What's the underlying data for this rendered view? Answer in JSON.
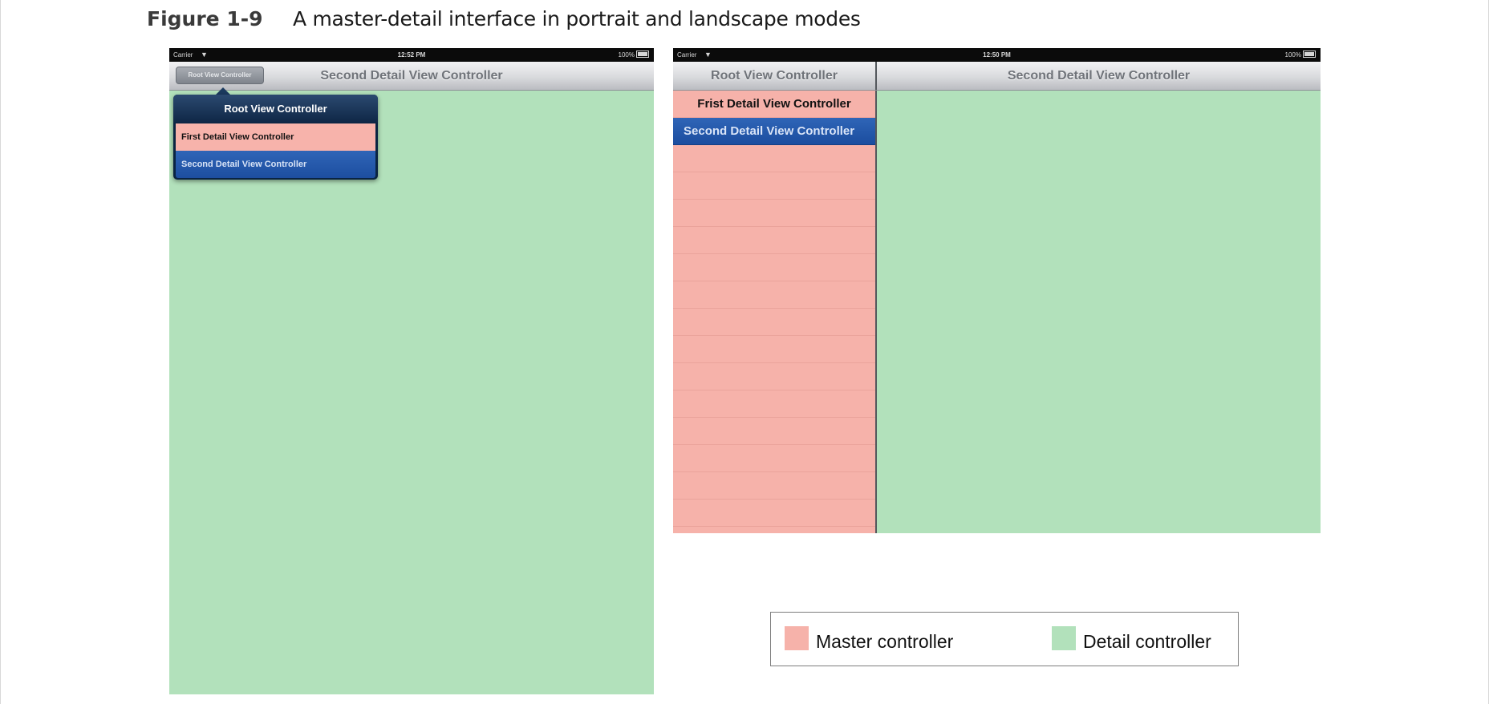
{
  "figure": {
    "number": "Figure 1-9",
    "title": "A master-detail interface in portrait and landscape modes"
  },
  "portrait": {
    "status_bar": {
      "carrier": "Carrier",
      "time": "12:52 PM",
      "battery": "100%"
    },
    "nav_bar": {
      "button_label": "Root View Controller",
      "title": "Second Detail View Controller"
    },
    "popover": {
      "title": "Root View Controller",
      "items": [
        {
          "label": "First Detail View Controller"
        },
        {
          "label": "Second Detail View Controller"
        }
      ]
    }
  },
  "landscape": {
    "status_bar": {
      "carrier": "Carrier",
      "time": "12:50 PM",
      "battery": "100%"
    },
    "nav_bar": {
      "master_title": "Root View Controller",
      "detail_title": "Second Detail View Controller"
    },
    "master_items": [
      {
        "label": "Frist Detail View Controller"
      },
      {
        "label": "Second Detail View Controller"
      }
    ]
  },
  "legend": {
    "items": [
      {
        "label": "Master controller",
        "color": "#f6b2aa"
      },
      {
        "label": "Detail controller",
        "color": "#b2e1bb"
      }
    ]
  },
  "colors": {
    "master": "#f6b2aa",
    "detail": "#b2e1bb",
    "selection_blue": "#2f65b7",
    "popover_navy": "#0a2442"
  },
  "icons": {
    "wifi": "wifi-icon",
    "battery": "battery-icon"
  }
}
